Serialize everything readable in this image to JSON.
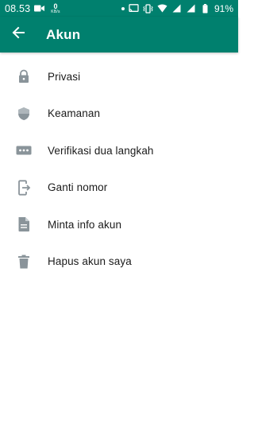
{
  "status_bar": {
    "time": "08.53",
    "net_speed_value": "0",
    "net_speed_unit": "KB/s",
    "battery_percent": "91%"
  },
  "app_bar": {
    "title": "Akun",
    "back_icon": "arrow-back-icon"
  },
  "colors": {
    "primary": "#00806e",
    "icon_gray": "#8a949a",
    "text": "#1b1b1b"
  },
  "menu": {
    "items": [
      {
        "label": "Privasi",
        "icon": "lock-icon"
      },
      {
        "label": "Keamanan",
        "icon": "shield-icon"
      },
      {
        "label": "Verifikasi dua langkah",
        "icon": "password-dots-icon"
      },
      {
        "label": "Ganti nomor",
        "icon": "change-number-icon"
      },
      {
        "label": "Minta info akun",
        "icon": "document-icon"
      },
      {
        "label": "Hapus akun saya",
        "icon": "trash-icon"
      }
    ]
  }
}
